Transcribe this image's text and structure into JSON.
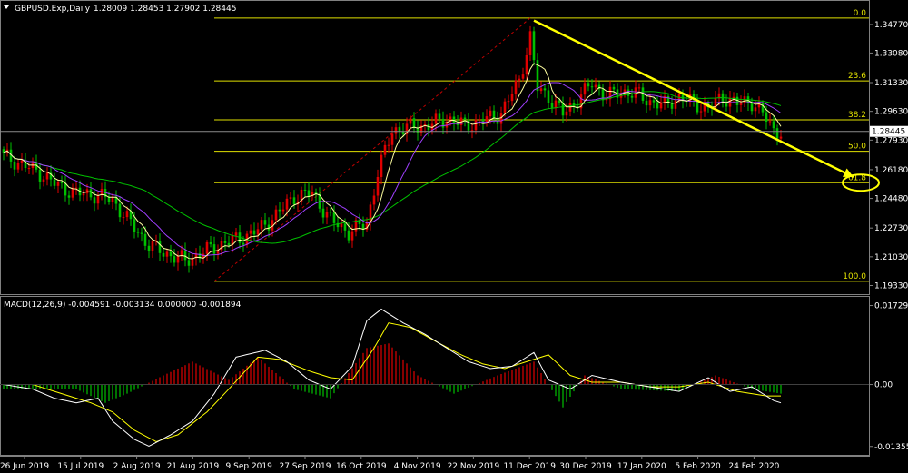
{
  "header": {
    "title": "GBPUSD.Exp,Daily",
    "ohlc": "1.28009 1.28453 1.27902 1.28445"
  },
  "colors": {
    "background": "#000000",
    "bull_candle": "#e00000",
    "bear_candle": "#00c000",
    "fib_lines": "#e0e000",
    "ma_fast": "#ffffa0",
    "ma_mid": "#a040ff",
    "ma_slow": "#00c000",
    "trend_arrow": "#ffff00",
    "macd_line": "#ffffff",
    "macd_signal": "#ffff00"
  },
  "chart_data": [
    {
      "type": "candlestick",
      "title": "GBPUSD.Exp,Daily",
      "price_axis": {
        "ticks": [
          "1.34770",
          "1.33080",
          "1.31330",
          "1.29630",
          "1.27930",
          "1.26180",
          "1.24480",
          "1.22730",
          "1.21030",
          "1.19330"
        ],
        "ylim": [
          1.1925,
          1.3525
        ]
      },
      "current_price": "1.28445",
      "time_axis": {
        "ticks": [
          "26 Jun 2019",
          "15 Jul 2019",
          "2 Aug 2019",
          "21 Aug 2019",
          "9 Sep 2019",
          "27 Sep 2019",
          "16 Oct 2019",
          "4 Nov 2019",
          "22 Nov 2019",
          "11 Dec 2019",
          "30 Dec 2019",
          "17 Jan 2020",
          "5 Feb 2020",
          "24 Feb 2020"
        ]
      },
      "fibonacci_levels": [
        {
          "label": "0.0",
          "price": 1.3515
        },
        {
          "label": "23.6",
          "price": 1.3143
        },
        {
          "label": "38.2",
          "price": 1.2913
        },
        {
          "label": "50.0",
          "price": 1.2727
        },
        {
          "label": "61.8",
          "price": 1.2541
        },
        {
          "label": "100.0",
          "price": 1.1958
        }
      ],
      "close_path": [
        [
          0,
          1.27
        ],
        [
          5,
          1.265
        ],
        [
          10,
          1.26
        ],
        [
          15,
          1.252
        ],
        [
          20,
          1.248
        ],
        [
          25,
          1.247
        ],
        [
          30,
          1.244
        ],
        [
          35,
          1.23
        ],
        [
          40,
          1.217
        ],
        [
          45,
          1.212
        ],
        [
          50,
          1.208
        ],
        [
          55,
          1.213
        ],
        [
          60,
          1.218
        ],
        [
          65,
          1.221
        ],
        [
          70,
          1.226
        ],
        [
          75,
          1.235
        ],
        [
          80,
          1.246
        ],
        [
          85,
          1.248
        ],
        [
          90,
          1.232
        ],
        [
          95,
          1.225
        ],
        [
          100,
          1.23
        ],
        [
          103,
          1.26
        ],
        [
          107,
          1.285
        ],
        [
          112,
          1.287
        ],
        [
          117,
          1.288
        ],
        [
          122,
          1.292
        ],
        [
          127,
          1.288
        ],
        [
          132,
          1.291
        ],
        [
          137,
          1.295
        ],
        [
          142,
          1.315
        ],
        [
          145,
          1.34
        ],
        [
          147,
          1.31
        ],
        [
          150,
          1.305
        ],
        [
          154,
          1.295
        ],
        [
          158,
          1.303
        ],
        [
          162,
          1.313
        ],
        [
          166,
          1.305
        ],
        [
          170,
          1.308
        ],
        [
          174,
          1.307
        ],
        [
          178,
          1.302
        ],
        [
          182,
          1.3
        ],
        [
          186,
          1.305
        ],
        [
          190,
          1.301
        ],
        [
          194,
          1.298
        ],
        [
          198,
          1.305
        ],
        [
          202,
          1.301
        ],
        [
          206,
          1.302
        ],
        [
          209,
          1.295
        ],
        [
          212,
          1.285
        ],
        [
          214,
          1.2845
        ]
      ],
      "trend_line": {
        "from": [
          146,
          1.35
        ],
        "to": [
          234,
          1.2575
        ]
      },
      "target_ellipse": {
        "x": 236,
        "price": 1.2541
      }
    },
    {
      "type": "line",
      "title": "MACD(12,26,9) -0.004591 -0.003134 0.000000 -0.001894",
      "ticks": [
        "0.017293",
        "0.00",
        "-0.013553"
      ],
      "ylim": [
        -0.014,
        0.0178
      ],
      "macd": [
        [
          0,
          0.0
        ],
        [
          8,
          -0.001
        ],
        [
          14,
          -0.003
        ],
        [
          20,
          -0.004
        ],
        [
          26,
          -0.003
        ],
        [
          30,
          -0.008
        ],
        [
          36,
          -0.012
        ],
        [
          40,
          -0.0135
        ],
        [
          46,
          -0.011
        ],
        [
          52,
          -0.008
        ],
        [
          58,
          -0.002
        ],
        [
          64,
          0.006
        ],
        [
          72,
          0.0075
        ],
        [
          78,
          0.005
        ],
        [
          84,
          0.001
        ],
        [
          90,
          -0.001
        ],
        [
          96,
          0.004
        ],
        [
          100,
          0.014
        ],
        [
          104,
          0.0165
        ],
        [
          110,
          0.0135
        ],
        [
          116,
          0.011
        ],
        [
          122,
          0.008
        ],
        [
          128,
          0.005
        ],
        [
          134,
          0.0035
        ],
        [
          140,
          0.004
        ],
        [
          146,
          0.007
        ],
        [
          150,
          0.001
        ],
        [
          156,
          -0.001
        ],
        [
          162,
          0.002
        ],
        [
          170,
          0.0005
        ],
        [
          178,
          -0.0005
        ],
        [
          186,
          -0.0015
        ],
        [
          194,
          0.0015
        ],
        [
          200,
          -0.0015
        ],
        [
          206,
          -0.0005
        ],
        [
          212,
          -0.0035
        ],
        [
          214,
          -0.004
        ]
      ],
      "signal": [
        [
          0,
          0.0
        ],
        [
          8,
          0.0
        ],
        [
          16,
          -0.002
        ],
        [
          24,
          -0.004
        ],
        [
          30,
          -0.006
        ],
        [
          36,
          -0.01
        ],
        [
          42,
          -0.0125
        ],
        [
          48,
          -0.011
        ],
        [
          56,
          -0.006
        ],
        [
          62,
          -0.001
        ],
        [
          70,
          0.006
        ],
        [
          76,
          0.0055
        ],
        [
          84,
          0.003
        ],
        [
          90,
          0.0015
        ],
        [
          96,
          0.001
        ],
        [
          102,
          0.008
        ],
        [
          106,
          0.0135
        ],
        [
          112,
          0.0125
        ],
        [
          120,
          0.009
        ],
        [
          126,
          0.0065
        ],
        [
          132,
          0.0045
        ],
        [
          138,
          0.0035
        ],
        [
          146,
          0.0055
        ],
        [
          150,
          0.0065
        ],
        [
          156,
          0.002
        ],
        [
          162,
          0.0005
        ],
        [
          170,
          0.0005
        ],
        [
          178,
          -0.0005
        ],
        [
          186,
          -0.0005
        ],
        [
          194,
          0.0005
        ],
        [
          202,
          -0.0015
        ],
        [
          210,
          -0.0025
        ],
        [
          214,
          -0.0025
        ]
      ],
      "histogram": [
        [
          0,
          -0.001
        ],
        [
          20,
          -0.001
        ],
        [
          28,
          -0.004
        ],
        [
          34,
          -0.002
        ],
        [
          44,
          0.002
        ],
        [
          52,
          0.005
        ],
        [
          62,
          0.001
        ],
        [
          70,
          0.006
        ],
        [
          80,
          -0.001
        ],
        [
          90,
          -0.003
        ],
        [
          100,
          0.008
        ],
        [
          106,
          0.009
        ],
        [
          114,
          0.002
        ],
        [
          124,
          -0.002
        ],
        [
          136,
          0.002
        ],
        [
          146,
          0.005
        ],
        [
          154,
          -0.005
        ],
        [
          160,
          0.002
        ],
        [
          170,
          -0.001
        ],
        [
          186,
          -0.0015
        ],
        [
          196,
          0.002
        ],
        [
          206,
          -0.001
        ],
        [
          214,
          -0.002
        ]
      ]
    }
  ]
}
